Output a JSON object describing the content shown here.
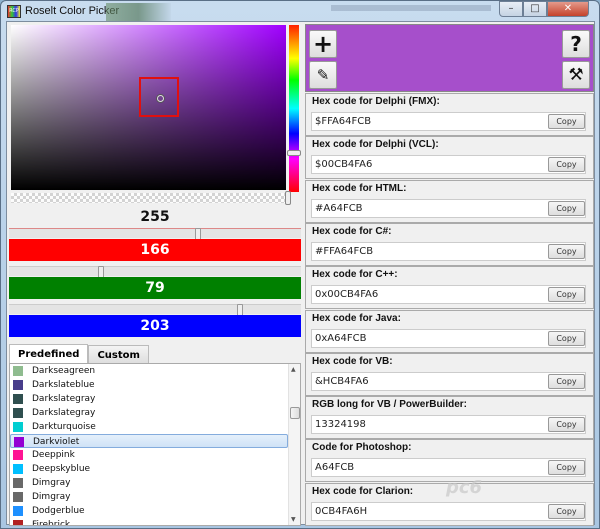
{
  "window": {
    "title": "Roselt Color Picker",
    "minimize": "–",
    "maximize": "□",
    "close": "✕"
  },
  "colors": {
    "current": "#A64FCB",
    "accent_red": "#FF0000",
    "accent_green": "#008000",
    "accent_blue": "#0000FF",
    "selection_box": "#E01010"
  },
  "picker": {
    "alpha": 255,
    "red": 166,
    "green": 79,
    "blue": 203,
    "alpha_fraction": 1.0,
    "red_fraction": 0.651,
    "green_fraction": 0.31,
    "blue_fraction": 0.796
  },
  "tabs": [
    {
      "label": "Predefined",
      "active": true
    },
    {
      "label": "Custom",
      "active": false
    }
  ],
  "color_list": [
    {
      "name": "Darkseagreen",
      "hex": "#8FBC8F"
    },
    {
      "name": "Darkslateblue",
      "hex": "#483D8B"
    },
    {
      "name": "Darkslategray",
      "hex": "#2F4F4F"
    },
    {
      "name": "Darkslategray",
      "hex": "#2F4F4F"
    },
    {
      "name": "Darkturquoise",
      "hex": "#00CED1"
    },
    {
      "name": "Darkviolet",
      "hex": "#9400D3",
      "selected": true
    },
    {
      "name": "Deeppink",
      "hex": "#FF1493"
    },
    {
      "name": "Deepskyblue",
      "hex": "#00BFFF"
    },
    {
      "name": "Dimgray",
      "hex": "#696969"
    },
    {
      "name": "Dimgray",
      "hex": "#696969"
    },
    {
      "name": "Dodgerblue",
      "hex": "#1E90FF"
    },
    {
      "name": "Firebrick",
      "hex": "#B22222"
    }
  ],
  "toolbar": {
    "add_icon": "+",
    "eyedropper_icon": "✎",
    "help_icon": "?",
    "settings_icon": "⚒"
  },
  "codes": [
    {
      "label": "Hex code for Delphi (FMX):",
      "value": "$FFA64FCB",
      "copy": "Copy"
    },
    {
      "label": "Hex code for Delphi (VCL):",
      "value": "$00CB4FA6",
      "copy": "Copy"
    },
    {
      "label": "Hex code for HTML:",
      "value": "#A64FCB",
      "copy": "Copy"
    },
    {
      "label": "Hex code for C#:",
      "value": "#FFA64FCB",
      "copy": "Copy"
    },
    {
      "label": "Hex code for C++:",
      "value": "0x00CB4FA6",
      "copy": "Copy"
    },
    {
      "label": "Hex code for Java:",
      "value": "0xA64FCB",
      "copy": "Copy"
    },
    {
      "label": "Hex code for VB:",
      "value": "&HCB4FA6",
      "copy": "Copy"
    },
    {
      "label": "RGB long for VB / PowerBuilder:",
      "value": "13324198",
      "copy": "Copy"
    },
    {
      "label": "Code for Photoshop:",
      "value": "A64FCB",
      "copy": "Copy"
    },
    {
      "label": "Hex code for Clarion:",
      "value": "0CB4FA6H",
      "copy": "Copy"
    }
  ],
  "watermark": "pc6"
}
